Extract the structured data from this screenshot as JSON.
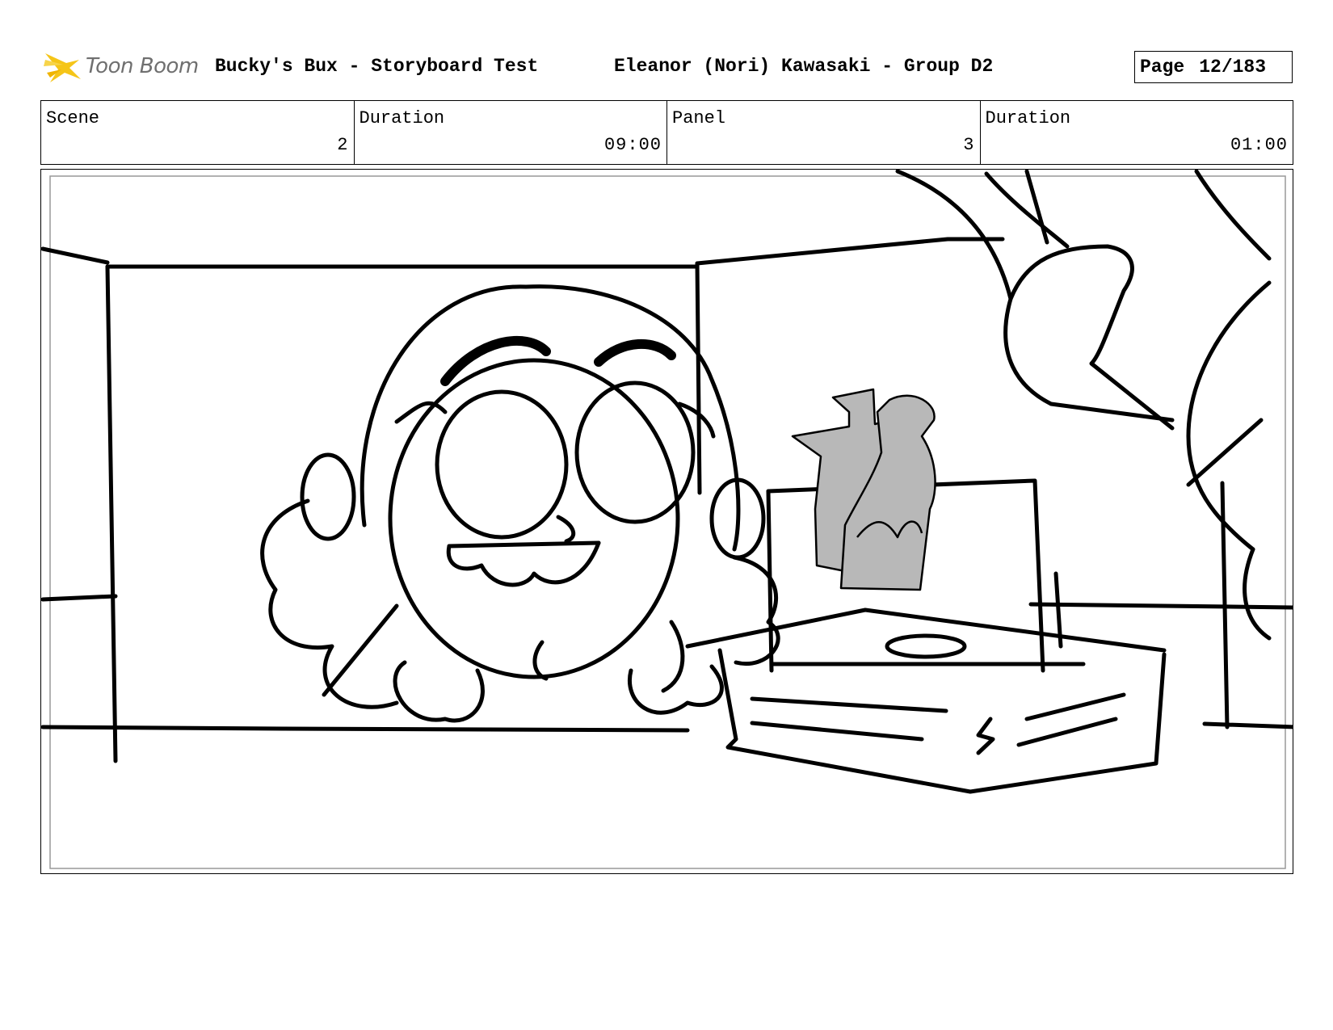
{
  "header": {
    "logo_text": "Toon Boom",
    "project_title": "Bucky's Bux - Storyboard Test",
    "author": "Eleanor (Nori) Kawasaki - Group D2",
    "page_label": "Page",
    "page_number": "12/183"
  },
  "info": [
    {
      "label": "Scene",
      "value": "2"
    },
    {
      "label": "Duration",
      "value": "09:00"
    },
    {
      "label": "Panel",
      "value": "3"
    },
    {
      "label": "Duration",
      "value": "01:00"
    }
  ],
  "colors": {
    "logo_accent": "#f5c518",
    "logo_text": "#6f6f6f",
    "figure_gray": "#b8b8b8"
  },
  "icons": {
    "logo": "toon-boom-star-icon"
  }
}
